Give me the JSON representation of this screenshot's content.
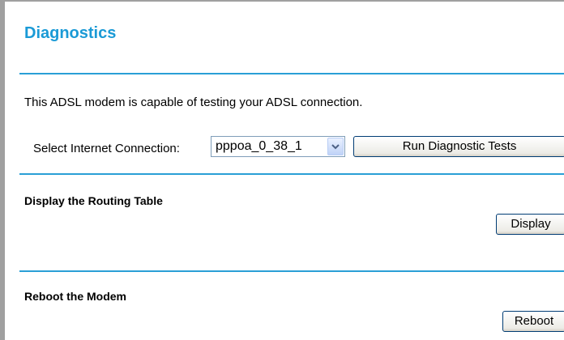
{
  "page": {
    "title": "Diagnostics",
    "description": "This ADSL modem is capable of testing your ADSL connection."
  },
  "connection": {
    "label": "Select Internet Connection:",
    "selected": "pppoa_0_38_1",
    "run_button": "Run Diagnostic Tests"
  },
  "routing": {
    "heading": "Display the Routing Table",
    "button": "Display"
  },
  "reboot": {
    "heading": "Reboot the Modem",
    "button": "Reboot"
  },
  "colors": {
    "title": "#1a9ad6",
    "rule": "#2a9fd6"
  },
  "icons": {
    "dropdown": "chevron-down-icon"
  }
}
